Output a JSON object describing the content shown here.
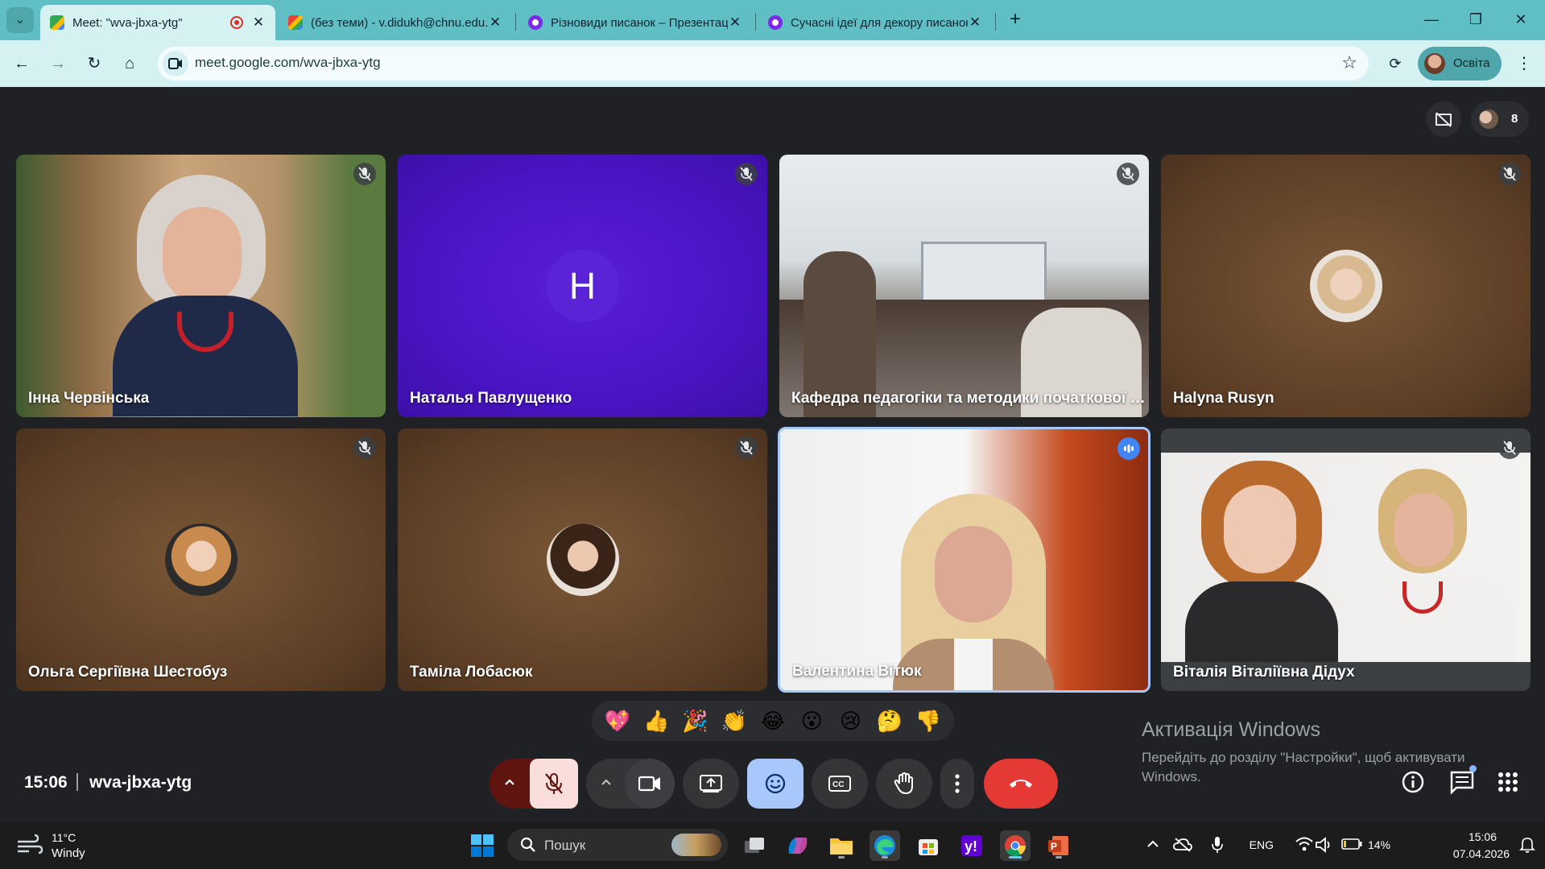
{
  "browser": {
    "tabs": [
      {
        "title": "Meet: \"wva-jbxa-ytg\"",
        "active": true
      },
      {
        "title": "(без теми) - v.didukh@chnu.edu.ua"
      },
      {
        "title": "Різновиди писанок – Презентація"
      },
      {
        "title": "Сучасні ідеї для декору писанок"
      }
    ],
    "url": "meet.google.com/wva-jbxa-ytg",
    "profile_label": "Освіта"
  },
  "meet": {
    "participant_count": "8",
    "tiles": [
      {
        "name": "Інна Червінська",
        "type": "video",
        "muted": true
      },
      {
        "name": "Наталья Павлущенко",
        "type": "initial",
        "initial": "Н",
        "muted": true
      },
      {
        "name": "Кафедра педагогіки та методики початкової освіти",
        "type": "video",
        "muted": true
      },
      {
        "name": "Halyna Rusyn",
        "type": "avatar",
        "muted": true
      },
      {
        "name": "Ольга Сергіївна Шестобуз",
        "type": "avatar",
        "muted": true
      },
      {
        "name": "Таміла Лобасюк",
        "type": "avatar",
        "muted": true
      },
      {
        "name": "Валентина Вітюк",
        "type": "video",
        "speaking": true
      },
      {
        "name": "Віталія Віталіївна Дідух",
        "type": "video",
        "muted": true
      }
    ],
    "reactions": [
      "💖",
      "👍",
      "🎉",
      "👏",
      "😂",
      "😮",
      "😢",
      "🤔",
      "👎"
    ],
    "time": "15:06",
    "meeting_code": "wva-jbxa-ytg"
  },
  "activation": {
    "title": "Активація Windows",
    "subtitle": "Перейдіть до розділу \"Настройки\", щоб активувати Windows."
  },
  "taskbar": {
    "weather_temp": "11°C",
    "weather_desc": "Windy",
    "search_label": "Пошук",
    "language": "ENG",
    "battery": "14%",
    "time": "15:06",
    "date": "07.04.2026"
  },
  "colors": {
    "chrome_frame": "#60bfc4",
    "chrome_toolbar": "#d6f1f2",
    "meet_bg": "#202124",
    "end_call": "#e53935",
    "mic_off": "#f9dedc",
    "reactions_active": "#a8c7fa",
    "initial_tile": "#4a14c4"
  }
}
